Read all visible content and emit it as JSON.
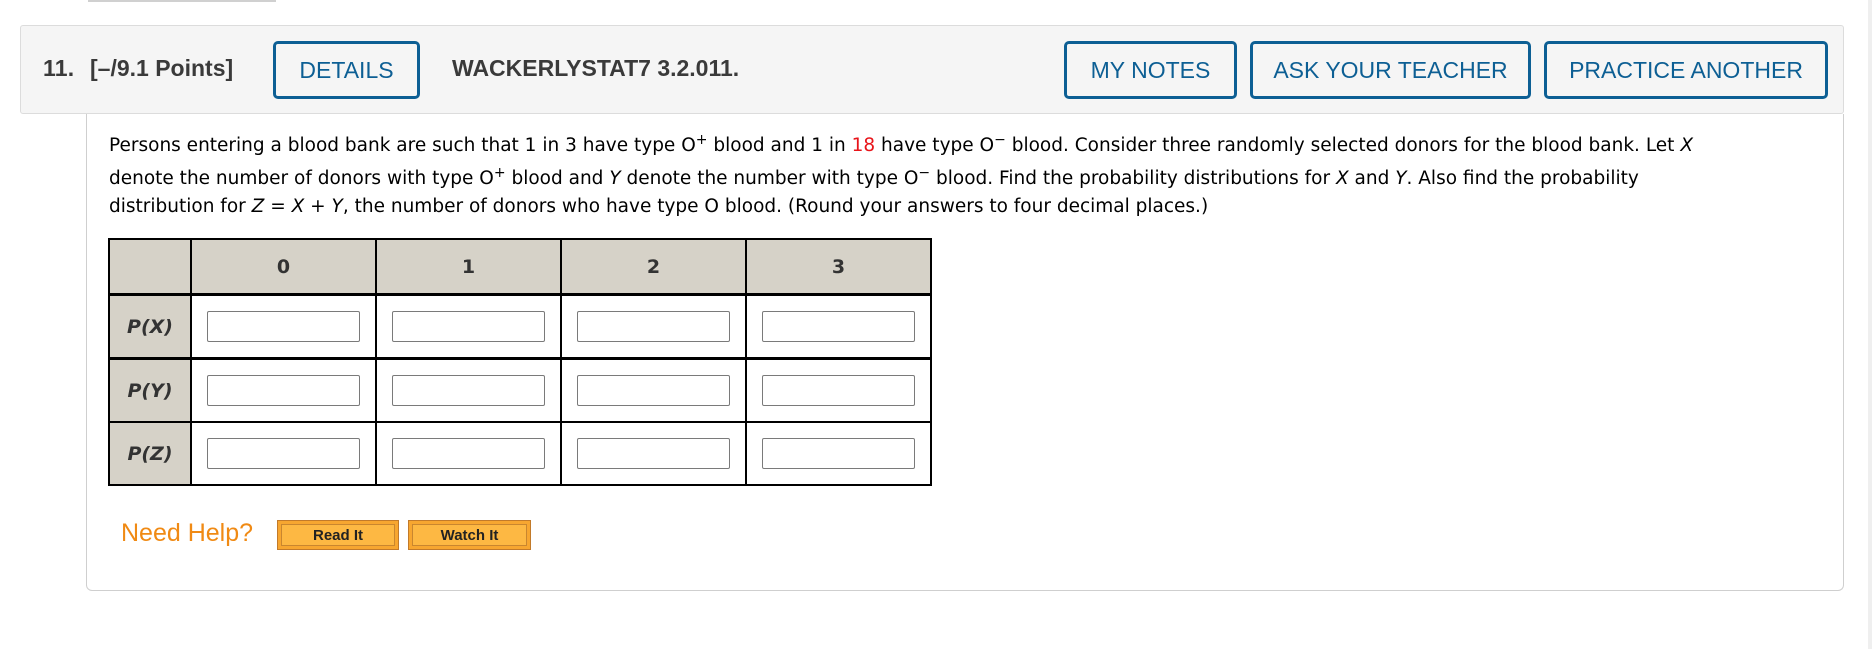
{
  "question": {
    "number": "11.",
    "points": "[–/9.1 Points]",
    "source_id": "WACKERLYSTAT7 3.2.011."
  },
  "header_buttons": {
    "details": "DETAILS",
    "my_notes": "MY NOTES",
    "ask_teacher": "ASK YOUR TEACHER",
    "practice_another": "PRACTICE ANOTHER"
  },
  "prompt": {
    "l1_a": "Persons entering a blood bank are such that 1 in 3 have type O",
    "sup_plus": "+",
    "l1_b": " blood and 1 in ",
    "highlight_value": "18",
    "l1_c": " have type O",
    "sup_minus": "−",
    "l1_d": " blood. Consider three randomly selected donors for the blood bank. Let ",
    "var_x": "X",
    "l2_a": "denote the number of donors with type O",
    "l2_b": " blood and ",
    "var_y": "Y",
    "l2_c": " denote the number with type O",
    "l2_d": " blood. Find the probability distributions for ",
    "l2_e": " and ",
    "l2_f": ". Also find the probability",
    "l3_a": "distribution for ",
    "var_z": "Z",
    "l3_b": " = ",
    "l3_c": " + ",
    "l3_d": ", the number of donors who have type O blood. (Round your answers to four decimal places.)"
  },
  "table": {
    "columns": [
      "0",
      "1",
      "2",
      "3"
    ],
    "rows": [
      {
        "label": "P(X)",
        "values": [
          "",
          "",
          "",
          ""
        ]
      },
      {
        "label": "P(Y)",
        "values": [
          "",
          "",
          "",
          ""
        ]
      },
      {
        "label": "P(Z)",
        "values": [
          "",
          "",
          "",
          ""
        ]
      }
    ]
  },
  "help": {
    "label": "Need Help?",
    "read_it": "Read It",
    "watch_it": "Watch It"
  },
  "colors": {
    "accent": "#0d5f94",
    "highlight": "#e8141a",
    "help_orange": "#f08a14",
    "table_header_bg": "#d6d2c8"
  }
}
